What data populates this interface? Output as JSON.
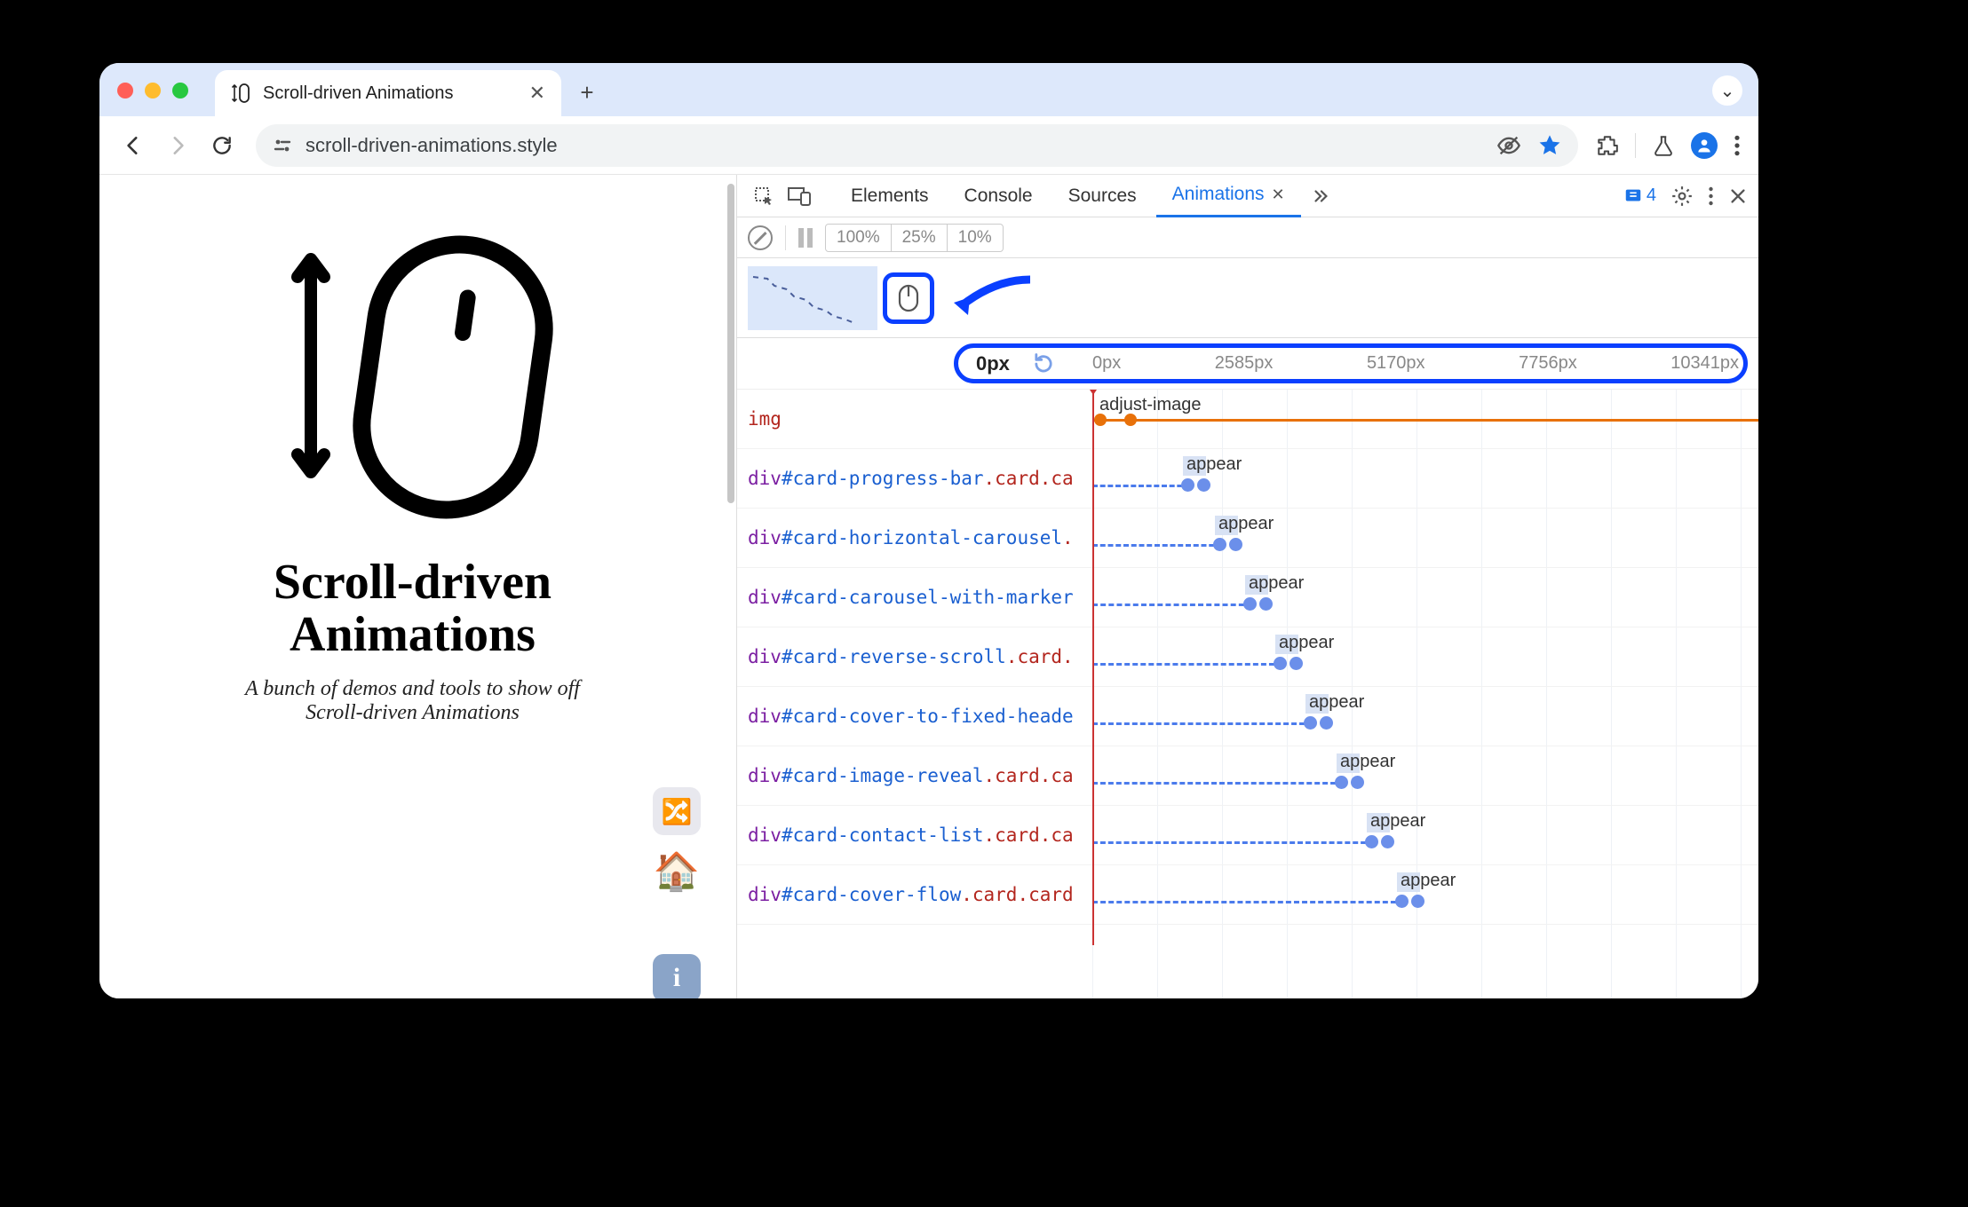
{
  "browser": {
    "tab_title": "Scroll-driven Animations",
    "url": "scroll-driven-animations.style",
    "new_tab_label": "+",
    "tab_caret": "⌄"
  },
  "page": {
    "heading_l1": "Scroll-driven",
    "heading_l2": "Animations",
    "subtitle_l1": "A bunch of demos and tools to show off",
    "subtitle_l2": "Scroll-driven Animations"
  },
  "devtools": {
    "tabs": [
      "Elements",
      "Console",
      "Sources",
      "Animations"
    ],
    "active_tab": "Animations",
    "message_count": "4",
    "speeds": [
      "100%",
      "25%",
      "10%"
    ]
  },
  "timeline": {
    "position_label": "0px",
    "ticks": [
      "0px",
      "2585px",
      "5170px",
      "7756px",
      "10341px"
    ],
    "rows": [
      {
        "tag": "img",
        "id": "",
        "suffix": "",
        "anim": "adjust-image",
        "type": "orange",
        "offset": 0
      },
      {
        "tag": "div",
        "id": "#card-progress-bar",
        "suffix": ".card.ca",
        "anim": "appear",
        "offset": 100
      },
      {
        "tag": "div",
        "id": "#card-horizontal-carousel",
        "suffix": ".",
        "anim": "appear",
        "offset": 136
      },
      {
        "tag": "div",
        "id": "#card-carousel-with-marker",
        "suffix": "",
        "anim": "appear",
        "offset": 170
      },
      {
        "tag": "div",
        "id": "#card-reverse-scroll",
        "suffix": ".card.",
        "anim": "appear",
        "offset": 204
      },
      {
        "tag": "div",
        "id": "#card-cover-to-fixed-heade",
        "suffix": "",
        "anim": "appear",
        "offset": 238
      },
      {
        "tag": "div",
        "id": "#card-image-reveal",
        "suffix": ".card.ca",
        "anim": "appear",
        "offset": 273
      },
      {
        "tag": "div",
        "id": "#card-contact-list",
        "suffix": ".card.ca",
        "anim": "appear",
        "offset": 307
      },
      {
        "tag": "div",
        "id": "#card-cover-flow",
        "suffix": ".card.card",
        "anim": "appear",
        "offset": 341
      }
    ]
  }
}
